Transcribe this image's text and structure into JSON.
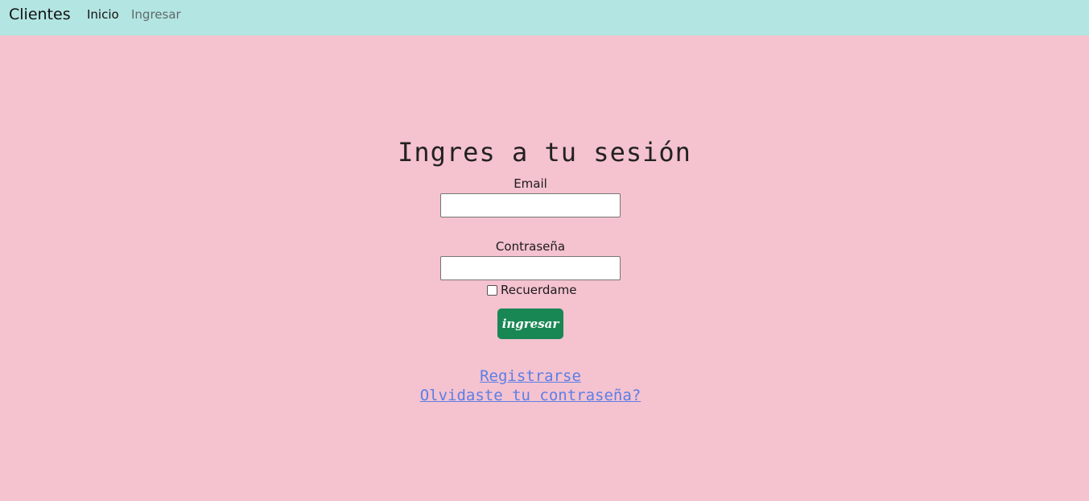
{
  "navbar": {
    "brand": "Clientes",
    "links": [
      "Inicio",
      "Ingresar"
    ]
  },
  "form": {
    "title": "Ingres a tu sesión",
    "email_label": "Email",
    "email_value": "",
    "password_label": "Contraseña",
    "password_value": "",
    "remember_label": "Recuerdame",
    "remember_checked": false,
    "submit_label": "ingresar"
  },
  "links": {
    "register": "Registrarse",
    "forgot": "Olvidaste tu contraseña?"
  },
  "colors": {
    "navbar_bg": "#b3e5e2",
    "page_bg": "#f5c2cf",
    "button_bg": "#198754",
    "link": "#5b7fe6"
  }
}
